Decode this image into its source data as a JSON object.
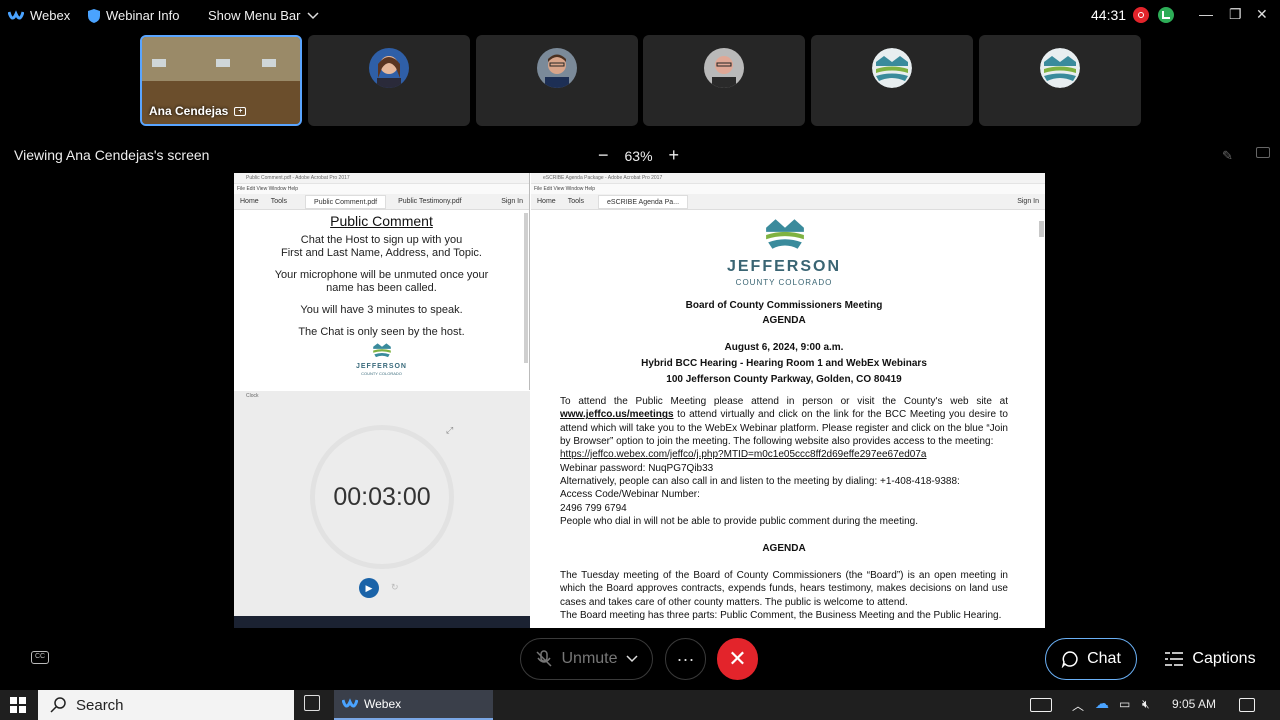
{
  "app": {
    "name": "Webex",
    "webinar_info": "Webinar Info",
    "show_menu_bar": "Show Menu Bar",
    "timer": "44:31"
  },
  "participants": [
    {
      "name": "Ana Cendejas",
      "kind": "room-video"
    },
    {
      "name": "",
      "kind": "avatar-woman"
    },
    {
      "name": "",
      "kind": "avatar-man-glasses"
    },
    {
      "name": "",
      "kind": "avatar-man-bald"
    },
    {
      "name": "",
      "kind": "avatar-logo"
    },
    {
      "name": "",
      "kind": "avatar-logo"
    }
  ],
  "share": {
    "viewing_label": "Viewing Ana Cendejas's screen",
    "zoom": "63%",
    "zoom_minus": "−",
    "zoom_plus": "+"
  },
  "left_pdf": {
    "window_title": "Public Comment.pdf - Adobe Acrobat Pro 2017",
    "menu": "File  Edit  View  Window  Help",
    "toolbar_home": "Home",
    "toolbar_tools": "Tools",
    "tab1": "Public Comment.pdf",
    "tab2": "Public Testimony.pdf",
    "sign_in": "Sign In",
    "title": "Public Comment",
    "p1_l1": "Chat the Host to sign up with you",
    "p1_l2": "First and Last Name, Address, and Topic.",
    "p2_l1": "Your microphone will be unmuted once your",
    "p2_l2": "name has been called.",
    "p3": "You will have 3 minutes to speak.",
    "p4": "The Chat is only seen by the host.",
    "logo_text": "JEFFERSON",
    "logo_sub": "COUNTY COLORADO"
  },
  "clock": {
    "window_title": "Clock",
    "time": "00:03:00"
  },
  "right_pdf": {
    "window_title": "eSCRIBE Agenda Package - Adobe Acrobat Pro 2017",
    "menu": "File  Edit  View  Window  Help",
    "toolbar_home": "Home",
    "toolbar_tools": "Tools",
    "tab1": "eSCRIBE Agenda Pa...",
    "sign_in": "Sign In",
    "logo_text": "JEFFERSON",
    "logo_sub": "COUNTY COLORADO",
    "h1": "Board of County Commissioners Meeting",
    "h2": "AGENDA",
    "date": "August 6, 2024, 9:00 a.m.",
    "venue": "Hybrid BCC Hearing - Hearing Room 1 and WebEx Webinars",
    "address": "100 Jefferson County Parkway, Golden, CO 80419",
    "para1_a": "To attend the Public Meeting please attend in person or visit the County's web site at",
    "para1_link": "www.jeffco.us/meetings",
    "para1_b": " to attend virtually and click on the link for the BCC Meeting you desire to attend which will take you to the WebEx Webinar platform.  Please register and click on the blue “Join by Browser” option to join the meeting. The following website also provides access to the meeting:",
    "url": "https://jeffco.webex.com/jeffco/j.php?MTID=m0c1e05ccc8ff2d69effe297ee67ed07a",
    "password": "Webinar password: NuqPG7Qib33",
    "callin": "Alternatively, people can also call in and listen to the meeting by dialing: +1-408-418-9388:",
    "access_label": "Access Code/Webinar Number:",
    "access_code": "2496 799 6794",
    "dialin_note": "People who dial in will not be able to provide public comment during the meeting.",
    "agenda_heading": "AGENDA",
    "para2": "The Tuesday meeting of the Board of County Commissioners (the “Board”) is an open meeting in which the Board approves contracts, expends funds, hears testimony, makes decisions on land use cases and takes care of other county matters. The public is welcome to attend.",
    "para3": "The Board meeting has three parts: Public Comment, the Business Meeting and the Public Hearing."
  },
  "controls": {
    "unmute": "Unmute",
    "more": "···",
    "leave": "✕",
    "chat": "Chat",
    "captions": "Captions"
  },
  "taskbar": {
    "search": "Search",
    "webex": "Webex",
    "time": "9:05 AM"
  },
  "colors": {
    "accent": "#5aa5ff",
    "leave_red": "#e3242b",
    "jeffco_green": "#7fb241",
    "jeffco_teal": "#3a8b9c"
  }
}
